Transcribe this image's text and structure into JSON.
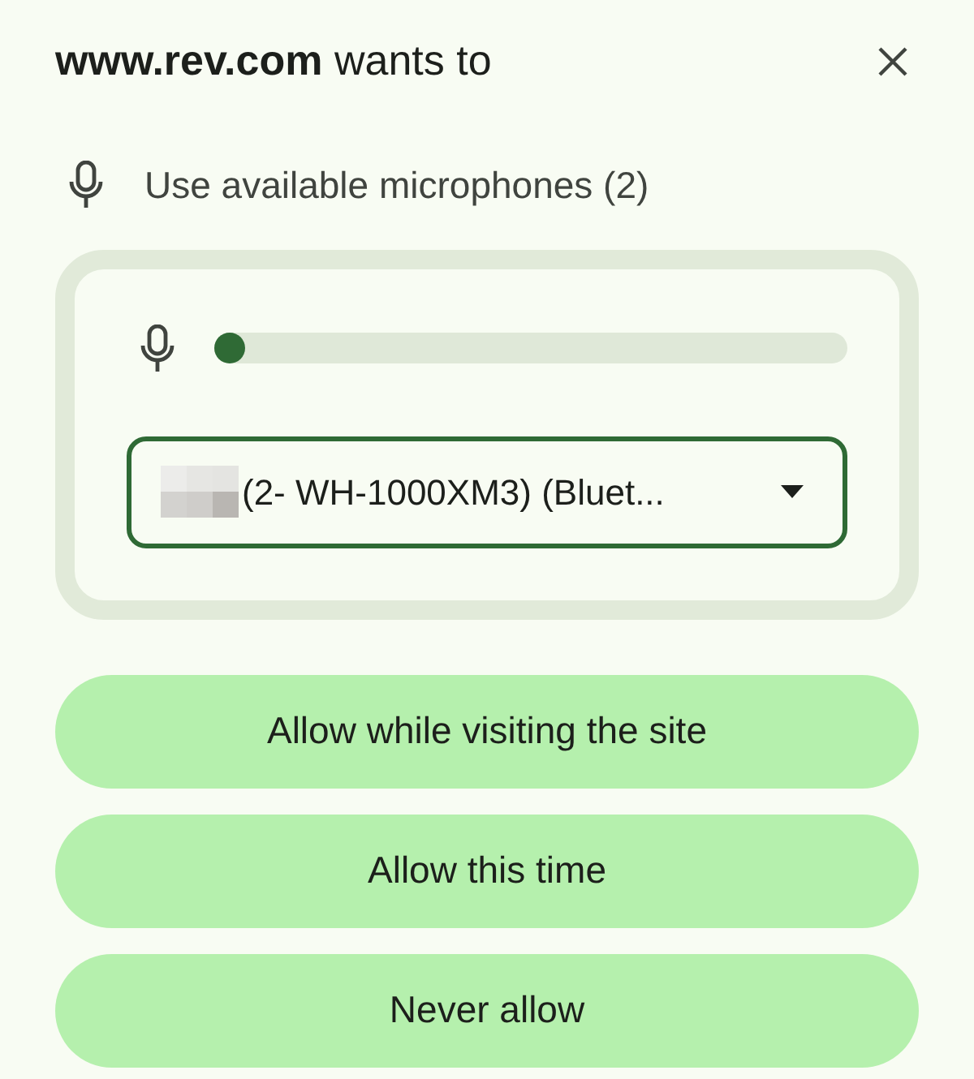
{
  "dialog": {
    "title": "**www.rev.com** wants to",
    "permission": "Use available microphones (2)"
  },
  "microphone": {
    "level": 0.0,
    "device": "(2- WH-1000XM3) (Bluet..."
  },
  "buttons": [
    "Allow while visiting the site",
    "Allow this time",
    "Never allow"
  ]
}
